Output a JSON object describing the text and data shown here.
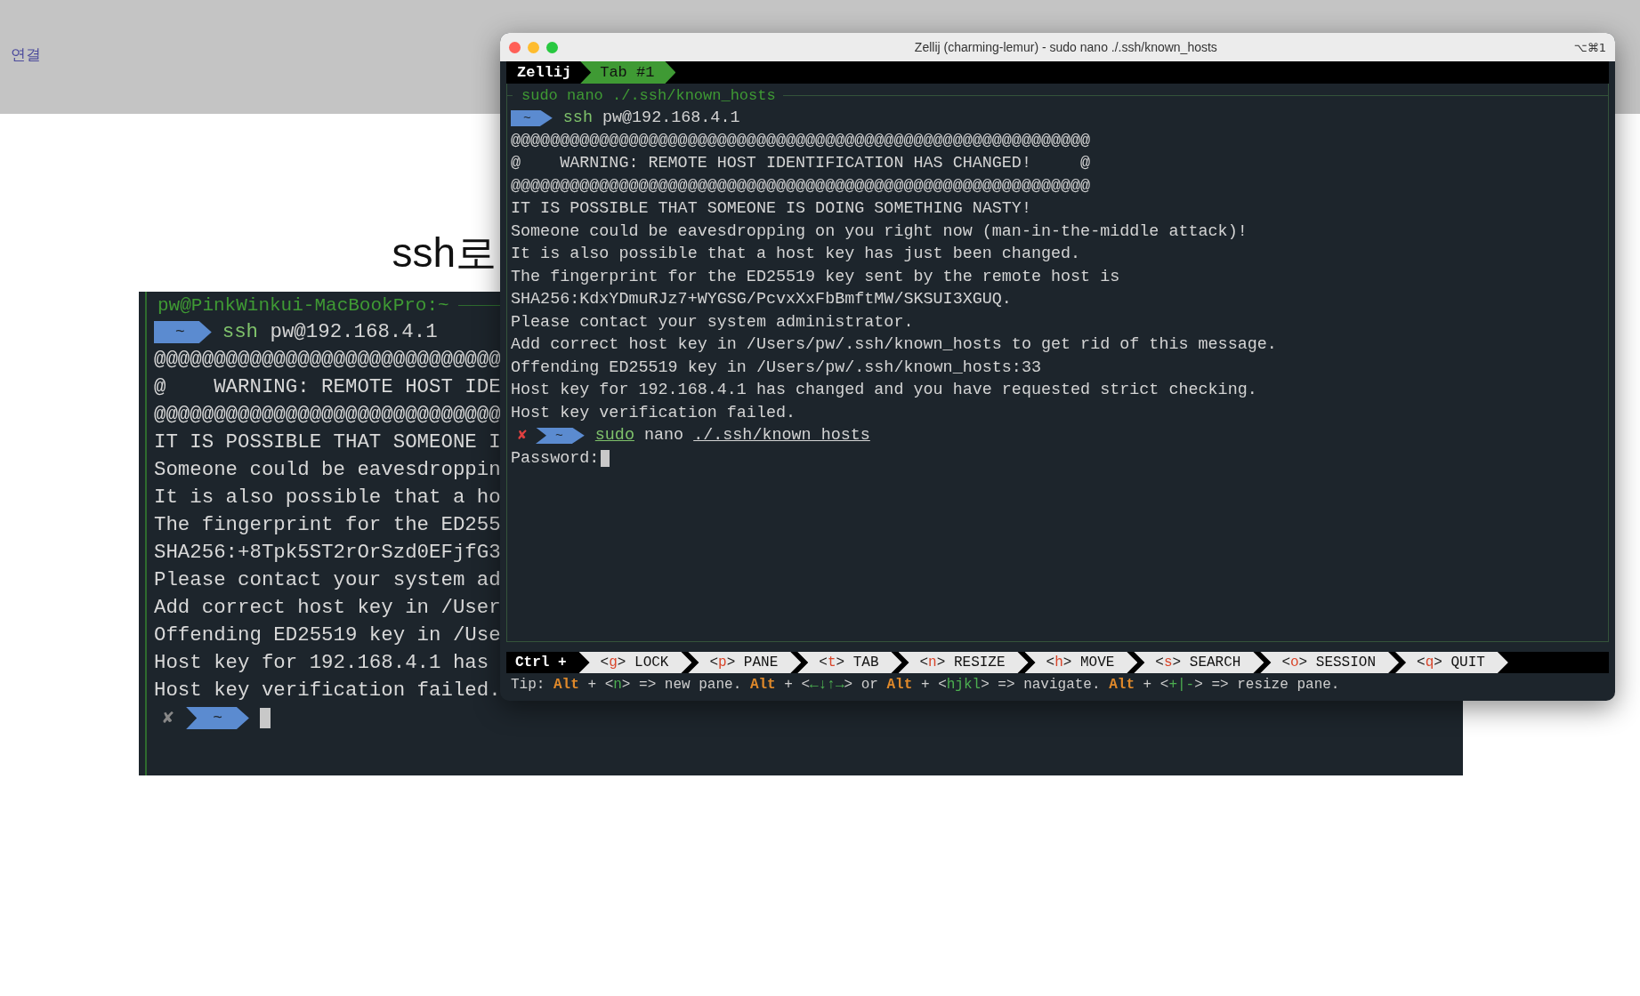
{
  "page": {
    "nav_link": "연결",
    "heading": "ssh로"
  },
  "back_terminal": {
    "title": "pw@PinkWinkui-MacBookPro:~",
    "lines": [
      {
        "kind": "prompt",
        "dir": "~",
        "parts": [
          {
            "text": "ssh",
            "kind": "cmd"
          },
          {
            "text": " pw@192.168.4.1",
            "kind": "arg"
          }
        ]
      },
      {
        "kind": "text",
        "text": "@@@@@@@@@@@@@@@@@@@@@@@@@@@@@"
      },
      {
        "kind": "text",
        "text": "@    WARNING: REMOTE HOST IDE"
      },
      {
        "kind": "text",
        "text": "@@@@@@@@@@@@@@@@@@@@@@@@@@@@@"
      },
      {
        "kind": "text",
        "text": "IT IS POSSIBLE THAT SOMEONE I"
      },
      {
        "kind": "text",
        "text": "Someone could be eavesdroppin"
      },
      {
        "kind": "text",
        "text": "It is also possible that a ho"
      },
      {
        "kind": "text",
        "text": "The fingerprint for the ED255"
      },
      {
        "kind": "text",
        "text": "SHA256:+8Tpk5ST2rOrSzd0EFjfG3"
      },
      {
        "kind": "text",
        "text": "Please contact your system ad"
      },
      {
        "kind": "text",
        "text": "Add correct host key in /User"
      },
      {
        "kind": "text",
        "text": "Offending ED25519 key in /Use"
      },
      {
        "kind": "text",
        "text": "Host key for 192.168.4.1 has"
      },
      {
        "kind": "text",
        "text": "Host key verification failed."
      },
      {
        "kind": "prompt",
        "error_mark": "✘",
        "dir": "~",
        "cursor": true
      }
    ]
  },
  "front_window": {
    "title": "Zellij (charming-lemur) - sudo nano ./.ssh/known_hosts",
    "shortcut": "⌥⌘1",
    "app_label": "Zellij",
    "tabs": [
      {
        "label": "Tab #1",
        "selected": true
      }
    ],
    "pane_title": "sudo nano ./.ssh/known_hosts",
    "lines": [
      {
        "kind": "prompt",
        "dir": "~",
        "parts": [
          {
            "text": "ssh",
            "kind": "cmd"
          },
          {
            "text": " pw@192.168.4.1",
            "kind": "arg"
          }
        ]
      },
      {
        "kind": "text",
        "text": "@@@@@@@@@@@@@@@@@@@@@@@@@@@@@@@@@@@@@@@@@@@@@@@@@@@@@@@@@@@"
      },
      {
        "kind": "text",
        "text": "@    WARNING: REMOTE HOST IDENTIFICATION HAS CHANGED!     @"
      },
      {
        "kind": "text",
        "text": "@@@@@@@@@@@@@@@@@@@@@@@@@@@@@@@@@@@@@@@@@@@@@@@@@@@@@@@@@@@"
      },
      {
        "kind": "text",
        "text": "IT IS POSSIBLE THAT SOMEONE IS DOING SOMETHING NASTY!"
      },
      {
        "kind": "text",
        "text": "Someone could be eavesdropping on you right now (man-in-the-middle attack)!"
      },
      {
        "kind": "text",
        "text": "It is also possible that a host key has just been changed."
      },
      {
        "kind": "text",
        "text": "The fingerprint for the ED25519 key sent by the remote host is"
      },
      {
        "kind": "text",
        "text": "SHA256:KdxYDmuRJz7+WYGSG/PcvxXxFbBmftMW/SKSUI3XGUQ."
      },
      {
        "kind": "text",
        "text": "Please contact your system administrator."
      },
      {
        "kind": "text",
        "text": "Add correct host key in /Users/pw/.ssh/known_hosts to get rid of this message."
      },
      {
        "kind": "text",
        "text": "Offending ED25519 key in /Users/pw/.ssh/known_hosts:33"
      },
      {
        "kind": "text",
        "text": "Host key for 192.168.4.1 has changed and you have requested strict checking."
      },
      {
        "kind": "text",
        "text": "Host key verification failed."
      },
      {
        "kind": "prompt",
        "error_mark": "✘",
        "dir": "~",
        "parts": [
          {
            "text": "sudo",
            "kind": "cmd",
            "underline": true
          },
          {
            "text": " nano ",
            "kind": "arg"
          },
          {
            "text": "./.ssh/known_hosts",
            "kind": "arg",
            "underline": true
          }
        ]
      },
      {
        "kind": "text",
        "text": "Password:",
        "cursor": true
      }
    ],
    "status_bar": {
      "modifier": "Ctrl +",
      "hints": [
        {
          "parts": [
            {
              "text": "<"
            },
            {
              "text": "g",
              "kind": "key"
            },
            {
              "text": "> LOCK"
            }
          ]
        },
        {
          "parts": [
            {
              "text": "<"
            },
            {
              "text": "p",
              "kind": "key"
            },
            {
              "text": "> PANE"
            }
          ]
        },
        {
          "parts": [
            {
              "text": "<"
            },
            {
              "text": "t",
              "kind": "key"
            },
            {
              "text": "> TAB"
            }
          ]
        },
        {
          "parts": [
            {
              "text": "<"
            },
            {
              "text": "n",
              "kind": "key"
            },
            {
              "text": "> RESIZE"
            }
          ]
        },
        {
          "parts": [
            {
              "text": "<"
            },
            {
              "text": "h",
              "kind": "key"
            },
            {
              "text": "> MOVE"
            }
          ]
        },
        {
          "parts": [
            {
              "text": "<"
            },
            {
              "text": "s",
              "kind": "key"
            },
            {
              "text": "> SEARCH"
            }
          ]
        },
        {
          "parts": [
            {
              "text": "<"
            },
            {
              "text": "o",
              "kind": "key"
            },
            {
              "text": "> SESSION"
            }
          ]
        },
        {
          "parts": [
            {
              "text": "<"
            },
            {
              "text": "q",
              "kind": "key"
            },
            {
              "text": "> QUIT"
            }
          ]
        }
      ]
    },
    "tip": [
      {
        "text": "Tip: "
      },
      {
        "text": "Alt",
        "kind": "mod"
      },
      {
        "text": " + <"
      },
      {
        "text": "n",
        "kind": "key"
      },
      {
        "text": "> => new pane. "
      },
      {
        "text": "Alt",
        "kind": "mod"
      },
      {
        "text": " + <"
      },
      {
        "text": "←↓↑→",
        "kind": "key"
      },
      {
        "text": "> or "
      },
      {
        "text": "Alt",
        "kind": "mod"
      },
      {
        "text": " + <"
      },
      {
        "text": "hjkl",
        "kind": "key"
      },
      {
        "text": "> => navigate. "
      },
      {
        "text": "Alt",
        "kind": "mod"
      },
      {
        "text": " + <"
      },
      {
        "text": "+|-",
        "kind": "key"
      },
      {
        "text": "> => resize pane."
      }
    ]
  }
}
